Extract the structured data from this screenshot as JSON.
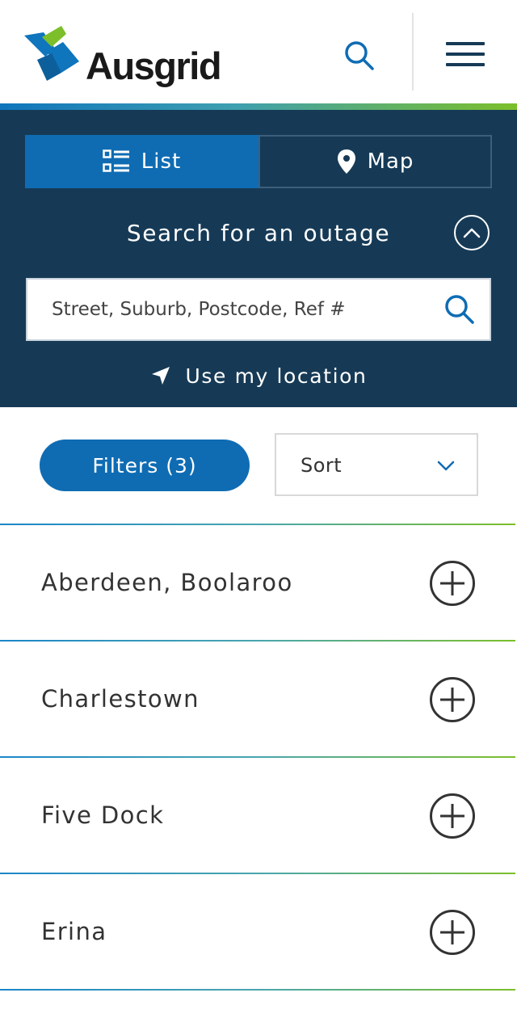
{
  "header": {
    "logo_text": "Ausgrid",
    "search_icon": "search-icon",
    "menu_icon": "hamburger-menu-icon"
  },
  "view_toggle": {
    "list_label": "List",
    "map_label": "Map",
    "selected": "List"
  },
  "search": {
    "heading": "Search for an outage",
    "placeholder": "Street, Suburb, Postcode, Ref #",
    "value": "",
    "use_location_label": "Use my location"
  },
  "filters": {
    "filters_label": "Filters (3)",
    "sort_label": "Sort"
  },
  "outages": [
    {
      "label": "Aberdeen, Boolaroo"
    },
    {
      "label": "Charlestown"
    },
    {
      "label": "Five Dock"
    },
    {
      "label": "Erina"
    }
  ],
  "colors": {
    "navy": "#163a56",
    "blue": "#0f6cb3",
    "green": "#7cbf2a",
    "text": "#333333"
  }
}
